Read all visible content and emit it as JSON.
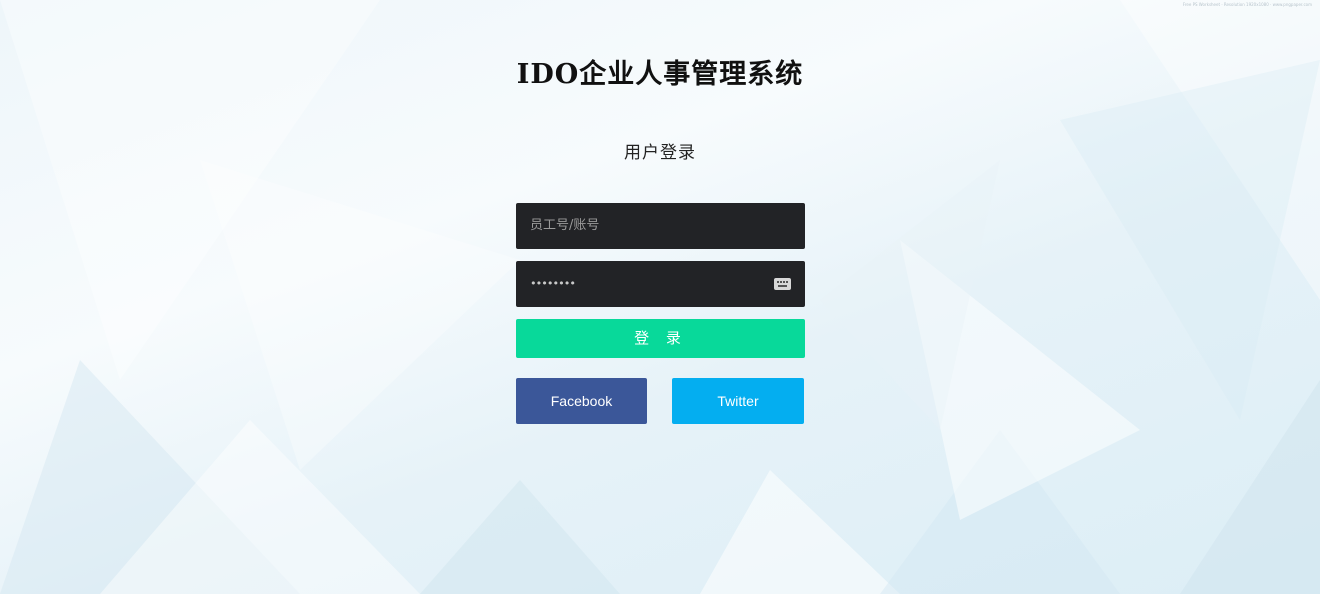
{
  "header": {
    "app_title": "IDO企业人事管理系统",
    "subtitle": "用户登录"
  },
  "form": {
    "username_placeholder": "员工号/账号",
    "password_mask": "••••••••",
    "login_label": "登 录"
  },
  "social": {
    "facebook_label": "Facebook",
    "twitter_label": "Twitter"
  },
  "watermark": "Free PS Worksheet · Resolution 1920x1080 · www.pngpaper.com",
  "colors": {
    "login_button": "#08d99a",
    "facebook": "#3b5799",
    "twitter": "#04aef0",
    "input_background": "#222326"
  }
}
